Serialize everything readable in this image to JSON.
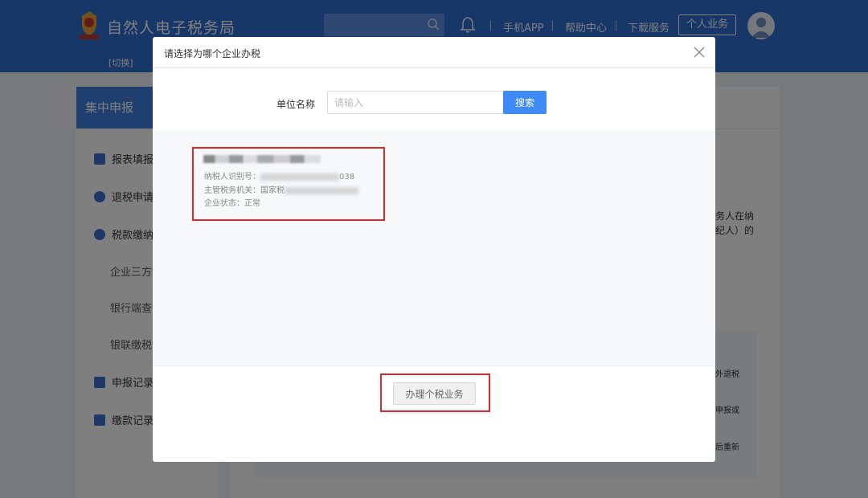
{
  "header": {
    "site_title": "自然人电子税务局",
    "switch_link": "[切换]",
    "nav": [
      "手机APP",
      "帮助中心",
      "下载服务"
    ],
    "personal_button": "个人业务"
  },
  "sidebar": {
    "title": "集中申报",
    "items": [
      {
        "label": "报表填报",
        "icon": "form-icon"
      },
      {
        "label": "退税申请",
        "icon": "refund-icon"
      },
      {
        "label": "税款缴纳",
        "icon": "payment-icon"
      },
      {
        "label": "申报记录",
        "icon": "record-search-icon"
      },
      {
        "label": "缴款记录",
        "icon": "payment-record-icon"
      }
    ],
    "sub_items": [
      "企业三方协",
      "银行端查询",
      "银联缴税"
    ]
  },
  "background_text": {
    "right_line_1": "务人在纳",
    "right_line_2": "纪人）的",
    "box_line_1": "外退税",
    "box_line_2": "申报或",
    "box_line_3": "后重新"
  },
  "modal": {
    "title": "请选择为哪个企业办税",
    "unit_label": "单位名称",
    "unit_placeholder": "请输入",
    "search_label": "搜索",
    "company": {
      "taxpayer_id_label": "纳税人识别号：",
      "taxpayer_id_suffix": "038",
      "authority_label": "主管税务机关：国家税",
      "status": "企业状态：正常"
    },
    "personal_tax_label": "办理个税业务"
  },
  "colors": {
    "header_blue": "#2f6fd3",
    "primary_button": "#3e8af7",
    "highlight_red": "#e12828"
  }
}
